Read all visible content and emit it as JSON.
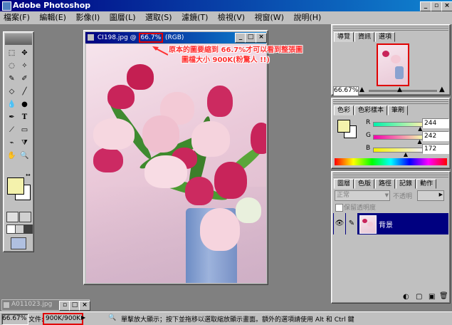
{
  "app": {
    "title": "Adobe Photoshop"
  },
  "menu": [
    "檔案(F)",
    "編輯(E)",
    "影像(I)",
    "圖層(L)",
    "選取(S)",
    "濾鏡(T)",
    "檢視(V)",
    "視窗(W)",
    "說明(H)"
  ],
  "toolbox": {
    "tools": [
      "marquee",
      "move",
      "lasso",
      "magic-wand",
      "brush",
      "eraser",
      "pencil",
      "line",
      "blur",
      "burn",
      "pen",
      "type",
      "measure",
      "gradient",
      "eyedropper",
      "paint-bucket",
      "hand",
      "zoom"
    ]
  },
  "document": {
    "filename": "CI198.jpg",
    "at": "@",
    "zoom": "66.7%",
    "mode": "(RGB)"
  },
  "annotation": {
    "line1": "原本的圖要縮到 66.7%才可以看到整張圖",
    "line2": "圖檔大小 900K(粉驚人 !!)",
    "color": "#ff3030"
  },
  "navigator": {
    "tabs": [
      "導覽",
      "資訊",
      "選項"
    ],
    "zoom": "66.67%"
  },
  "color_panel": {
    "tabs": [
      "色彩",
      "色彩樣本",
      "筆刷"
    ],
    "channels": [
      {
        "label": "R",
        "value": "244",
        "level": 0.96
      },
      {
        "label": "G",
        "value": "242",
        "level": 0.95
      },
      {
        "label": "B",
        "value": "172",
        "level": 0.67
      }
    ],
    "swatch": "#f4f2ac"
  },
  "layers_panel": {
    "tabs": [
      "圖層",
      "色版",
      "路徑",
      "記錄",
      "動作"
    ],
    "blend_mode": "正常",
    "opacity_label": "不透明",
    "preserve_label": "保留透明度",
    "layer_name": "背景"
  },
  "minimized_window": {
    "title": "A011023.jpg"
  },
  "status": {
    "zoom": "66.67%",
    "doc_label": "文件:",
    "doc_size": "900K/900K",
    "hint": "單擊放大顯示；按下並拖移以選取縮放顯示畫面。額外的選項請使用 Alt 和 Ctrl 鍵"
  },
  "colors": {
    "foreground": "#f4f2ac",
    "background": "#ffffff",
    "highlight_box": "#e00000"
  }
}
